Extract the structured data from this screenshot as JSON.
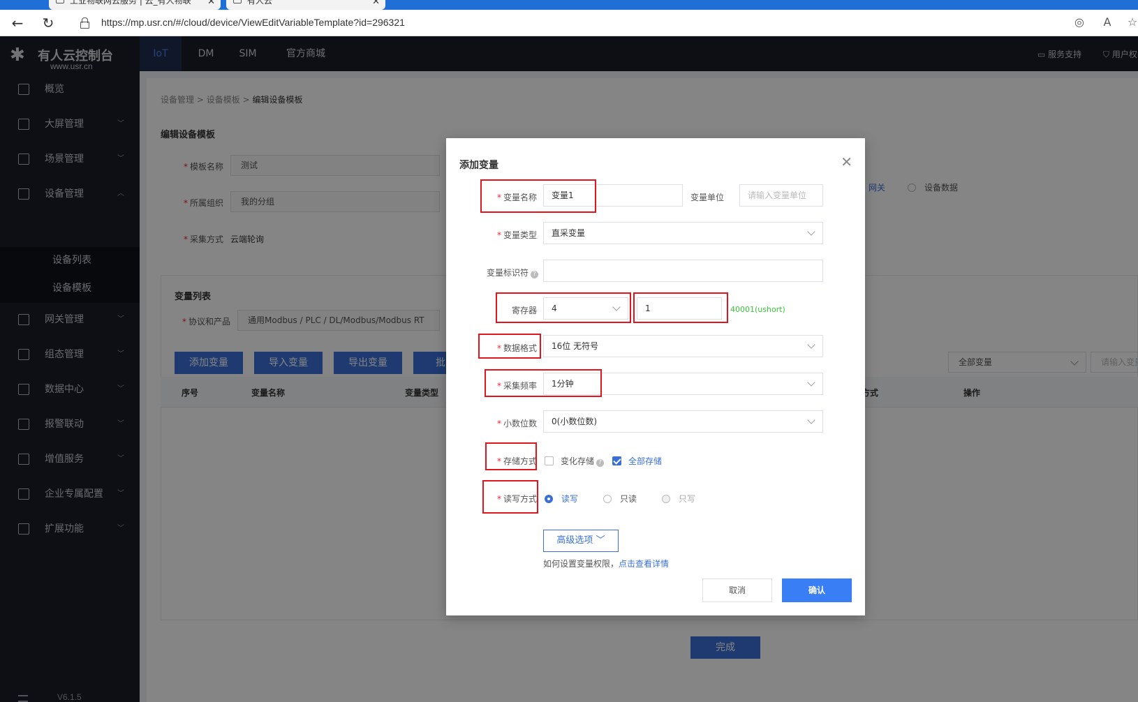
{
  "browser": {
    "tabs": [
      {
        "label": "工业物联网云服务 | 云_有人物联"
      },
      {
        "label": "有人云"
      }
    ],
    "url": "https://mp.usr.cn/#/cloud/device/ViewEditVariableTemplate?id=296321"
  },
  "sidebar": {
    "logo_title": "有人云控制台",
    "logo_sub": "www.usr.cn",
    "items": [
      {
        "label": "概览"
      },
      {
        "label": "大屏管理"
      },
      {
        "label": "场景管理"
      },
      {
        "label": "设备管理"
      },
      {
        "label": "网关管理"
      },
      {
        "label": "组态管理"
      },
      {
        "label": "数据中心"
      },
      {
        "label": "报警联动"
      },
      {
        "label": "增值服务"
      },
      {
        "label": "企业专属配置"
      },
      {
        "label": "扩展功能"
      }
    ],
    "sub_items": [
      {
        "label": "设备列表"
      },
      {
        "label": "设备模板"
      }
    ],
    "version": "V6.1.5"
  },
  "topnav": {
    "items": [
      {
        "label": "IoT"
      },
      {
        "label": "DM"
      },
      {
        "label": "SIM"
      },
      {
        "label": "官方商城"
      }
    ],
    "support": "服务支持",
    "user": "用户权"
  },
  "page": {
    "breadcrumb": [
      "设备管理",
      "设备模板",
      "编辑设备模板"
    ],
    "title": "编辑设备模板",
    "template_name_label": "模板名称",
    "template_name_value": "测试",
    "org_label": "所属组织",
    "org_value": "我的分组",
    "collect_label": "采集方式",
    "collect_value": "云端轮询",
    "radio_gateway": "网关",
    "radio_device_data": "设备数据",
    "var_list_title": "变量列表",
    "protocol_label": "协议和产品",
    "protocol_value": "通用Modbus / PLC / DL/Modbus/Modbus RT",
    "buttons": {
      "add": "添加变量",
      "import": "导入变量",
      "export": "导出变量",
      "batch": "批"
    },
    "filter_select": "全部变量",
    "filter_search": "请输入变量",
    "columns": [
      "序号",
      "变量名称",
      "变量类型",
      "存储方式",
      "操作"
    ],
    "finish": "完成"
  },
  "modal": {
    "title": "添加变量",
    "name_label": "变量名称",
    "name_value": "变量1",
    "unit_label": "变量单位",
    "unit_placeholder": "请输入变量单位",
    "type_label": "变量类型",
    "type_value": "直采变量",
    "identifier_label": "变量标识符",
    "register_label": "寄存器",
    "register_type": "4",
    "register_addr": "1",
    "register_hint": "40001(ushort)",
    "format_label": "数据格式",
    "format_value": "16位 无符号",
    "freq_label": "采集频率",
    "freq_value": "1分钟",
    "decimal_label": "小数位数",
    "decimal_value": "0(小数位数)",
    "storage_label": "存储方式",
    "storage_change": "变化存储",
    "storage_all": "全部存储",
    "rw_label": "读写方式",
    "rw_readwrite": "读写",
    "rw_readonly": "只读",
    "rw_writeonly": "只写",
    "advanced": "高级选项",
    "permission_text": "如何设置变量权限，",
    "permission_link": "点击查看详情",
    "cancel": "取消",
    "confirm": "确认"
  },
  "colors": {
    "accent": "#3a6fd8",
    "highlight": "#e3141c",
    "sidebar_bg": "#1a1d29"
  }
}
